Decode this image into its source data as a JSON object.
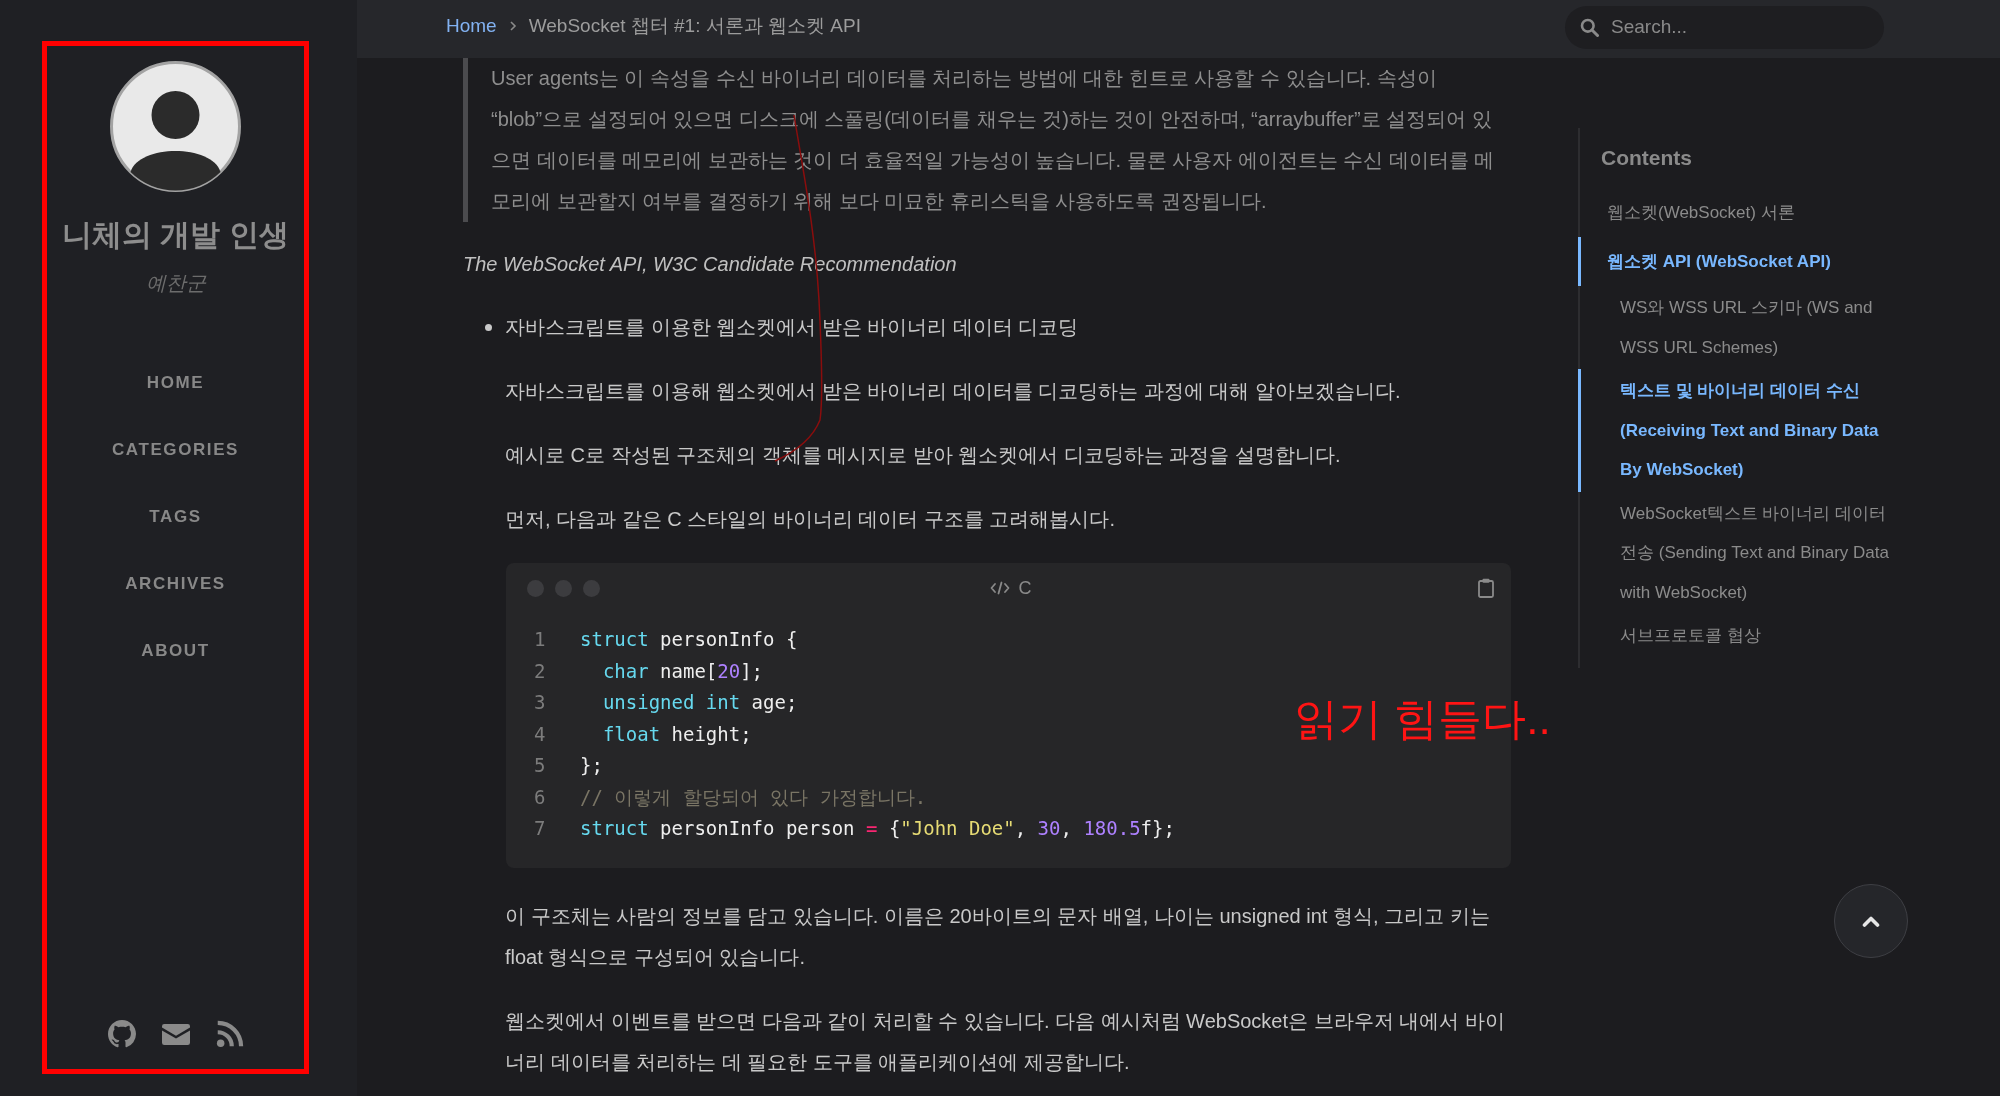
{
  "sidebar": {
    "title": "니체의 개발 인생",
    "subtitle": "예찬군",
    "nav": [
      {
        "label": "HOME"
      },
      {
        "label": "CATEGORIES"
      },
      {
        "label": "TAGS"
      },
      {
        "label": "ARCHIVES"
      },
      {
        "label": "ABOUT"
      }
    ]
  },
  "topbar": {
    "breadcrumb": [
      {
        "kind": "link",
        "label": "Home"
      },
      {
        "kind": "current",
        "label": "WebSocket 챕터 #1: 서론과 웹소켓 API"
      }
    ],
    "search": {
      "placeholder": "Search..."
    }
  },
  "article": {
    "blocks": [
      {
        "kind": "quote",
        "text": "User agents는 이 속성을 수신 바이너리 데이터를 처리하는 방법에 대한 힌트로 사용할 수 있습니다. 속성이 “blob”으로 설정되어 있으면 디스크에 스풀링(데이터를 채우는 것)하는 것이 안전하며, “arraybuffer”로 설정되어 있으면 데이터를 메모리에 보관하는 것이 더 효율적일 가능성이 높습니다. 물론 사용자 에이전트는 수신 데이터를 메모리에 보관할지 여부를 결정하기 위해 보다 미묘한 휴리스틱을 사용하도록 권장됩니다."
      },
      {
        "kind": "caption",
        "text": "The WebSocket API, W3C Candidate Recommendation"
      },
      {
        "kind": "bullet",
        "text": "자바스크립트를 이용한 웹소켓에서 받은 바이너리 데이터 디코딩",
        "children": [
          {
            "kind": "paragraph",
            "text": "자바스크립트를 이용해 웹소켓에서 받은 바이너리 데이터를 디코딩하는 과정에 대해 알아보겠습니다."
          },
          {
            "kind": "paragraph",
            "text": "예시로 C로 작성된 구조체의 객체를 메시지로 받아 웹소켓에서 디코딩하는 과정을 설명합니다."
          },
          {
            "kind": "paragraph",
            "text": "먼저, 다음과 같은 C 스타일의 바이너리 데이터 구조를 고려해봅시다."
          },
          {
            "kind": "code",
            "language": "C",
            "lines": [
              {
                "number": "1",
                "tokens": [
                  {
                    "kind": "keyword",
                    "text": "struct"
                  },
                  {
                    "kind": "plain",
                    "text": " personInfo {"
                  }
                ]
              },
              {
                "number": "2",
                "tokens": [
                  {
                    "kind": "keyword",
                    "text": "  char"
                  },
                  {
                    "kind": "plain",
                    "text": " name["
                  },
                  {
                    "kind": "number",
                    "text": "20"
                  },
                  {
                    "kind": "plain",
                    "text": "];"
                  }
                ]
              },
              {
                "number": "3",
                "tokens": [
                  {
                    "kind": "keyword",
                    "text": "  unsigned"
                  },
                  {
                    "kind": "keyword",
                    "text": " int"
                  },
                  {
                    "kind": "plain",
                    "text": " age;"
                  }
                ]
              },
              {
                "number": "4",
                "tokens": [
                  {
                    "kind": "keyword",
                    "text": "  float"
                  },
                  {
                    "kind": "plain",
                    "text": " height;"
                  }
                ]
              },
              {
                "number": "5",
                "tokens": [
                  {
                    "kind": "plain",
                    "text": "};"
                  }
                ]
              },
              {
                "number": "6",
                "tokens": [
                  {
                    "kind": "comment",
                    "text": "// 이렇게 할당되어 있다 가정합니다."
                  }
                ]
              },
              {
                "number": "7",
                "tokens": [
                  {
                    "kind": "keyword",
                    "text": "struct"
                  },
                  {
                    "kind": "plain",
                    "text": " personInfo person "
                  },
                  {
                    "kind": "operator",
                    "text": "="
                  },
                  {
                    "kind": "plain",
                    "text": " {"
                  },
                  {
                    "kind": "string",
                    "text": "\"John Doe\""
                  },
                  {
                    "kind": "plain",
                    "text": ", "
                  },
                  {
                    "kind": "number",
                    "text": "30"
                  },
                  {
                    "kind": "plain",
                    "text": ", "
                  },
                  {
                    "kind": "number",
                    "text": "180.5"
                  },
                  {
                    "kind": "plain",
                    "text": "f};"
                  }
                ]
              }
            ]
          },
          {
            "kind": "paragraph",
            "text": "이 구조체는 사람의 정보를 담고 있습니다. 이름은 20바이트의 문자 배열, 나이는 unsigned int 형식, 그리고 키는 float 형식으로 구성되어 있습니다."
          },
          {
            "kind": "paragraph",
            "text": "웹소켓에서 이벤트를 받으면 다음과 같이 처리할 수 있습니다. 다음 예시처럼 WebSocket은 브라우저 내에서 바이너리 데이터를 처리하는 데 필요한 도구를 애플리케이션에 제공합니다."
          }
        ]
      }
    ]
  },
  "toc": {
    "title": "Contents",
    "items": [
      {
        "label": "웹소켓(WebSocket) 서론",
        "selected": false
      },
      {
        "label": "웹소켓 API (WebSocket API)",
        "selected": true,
        "children": [
          {
            "label": "WS와 WSS URL 스키마 (WS and WSS URL Schemes)",
            "selected": false
          },
          {
            "label": "텍스트 및 바이너리 데이터 수신 (Receiving Text and Binary Data By WebSocket)",
            "selected": true
          },
          {
            "label": "WebSocket텍스트 바이너리 데이터 전송 (Sending Text and Binary Data with WebSocket)",
            "selected": false
          },
          {
            "label": "서브프로토콜 협상",
            "selected": false
          }
        ]
      }
    ]
  },
  "annotation": {
    "note": "읽기 힘들다.."
  }
}
